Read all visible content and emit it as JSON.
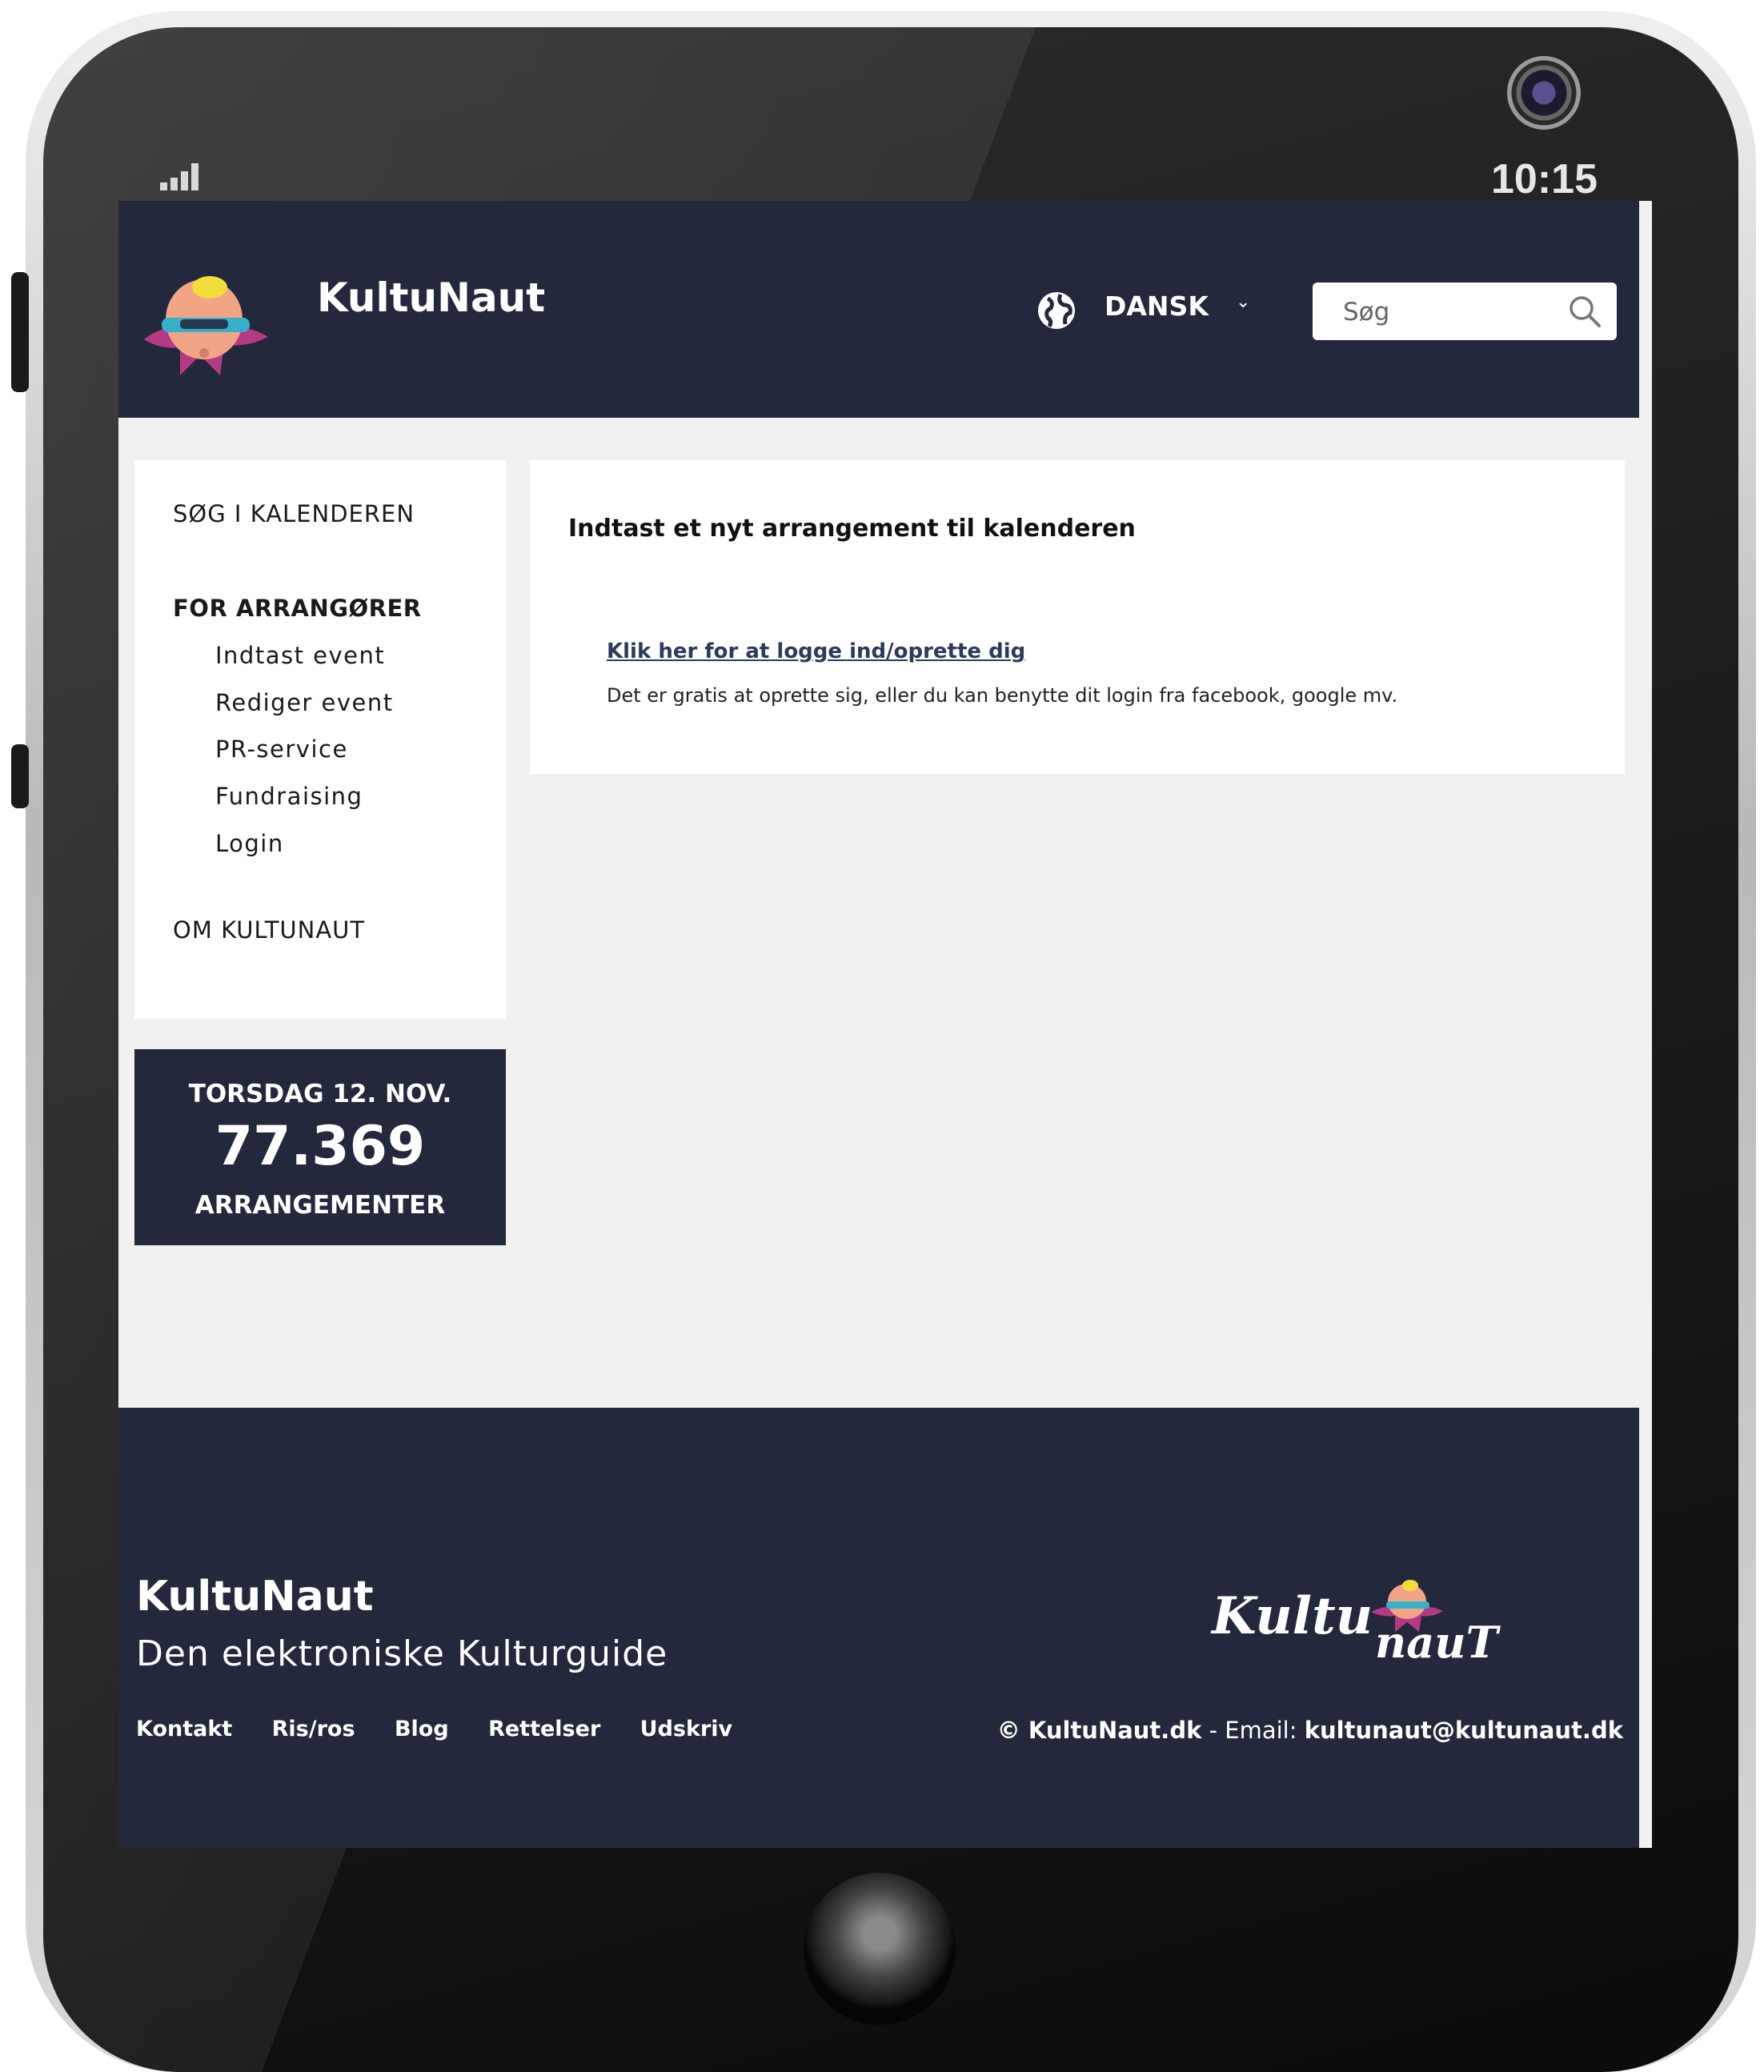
{
  "status_bar": {
    "time": "10:15"
  },
  "header": {
    "site_title": "KultuNaut",
    "language": "DANSK",
    "search_placeholder": "Søg"
  },
  "sidebar": {
    "search_calendar": "SØG I KALENDEREN",
    "organizers_heading": "FOR ARRANGØRER",
    "organizer_items": [
      "Indtast event",
      "Rediger event",
      "PR-service",
      "Fundraising",
      "Login"
    ],
    "about": "OM KULTUNAUT"
  },
  "counter": {
    "date": "TORSDAG 12. NOV.",
    "count": "77.369",
    "label": "ARRANGEMENTER"
  },
  "main": {
    "title": "Indtast et nyt arrangement til kalenderen",
    "login_link": "Klik her for at logge ind/oprette dig",
    "info": "Det er gratis at oprette sig, eller du kan benytte dit login fra facebook, google mv."
  },
  "footer": {
    "title": "KultuNaut",
    "subtitle": "Den elektroniske Kulturguide",
    "links": [
      "Kontakt",
      "Ris/ros",
      "Blog",
      "Rettelser",
      "Udskriv"
    ],
    "copyright": "© KultuNaut.dk",
    "email_label": " - Email: ",
    "email": "kultunaut@kultunaut.dk",
    "logo_text": "KultunauT"
  },
  "colors": {
    "navy": "#23283c",
    "background": "#f1f1f1",
    "link": "#2d3a5c"
  }
}
